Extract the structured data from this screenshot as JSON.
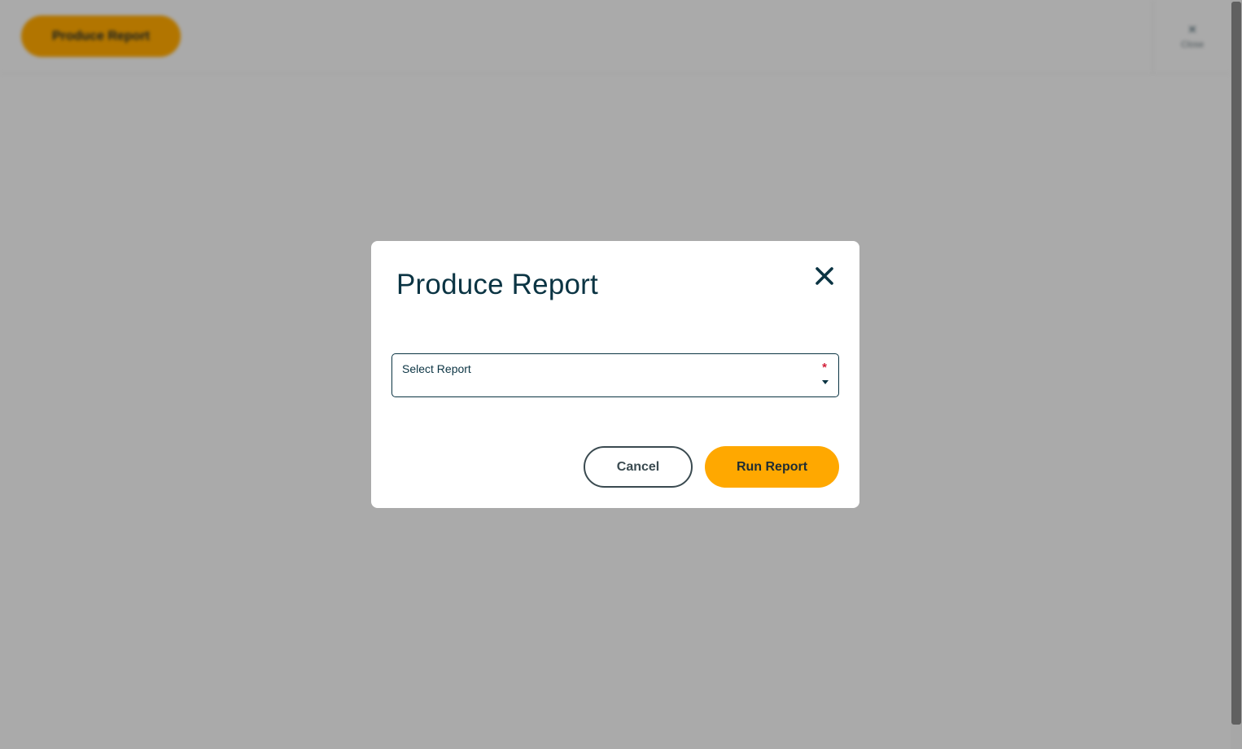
{
  "page": {
    "produce_report_button": "Produce Report",
    "side_panel_label": "Close"
  },
  "dialog": {
    "title": "Produce Report",
    "select": {
      "label": "Select Report",
      "required_marker": "*",
      "value": ""
    },
    "cancel_label": "Cancel",
    "run_label": "Run Report"
  },
  "icons": {
    "close": "close-icon",
    "dropdown": "chevron-down-icon"
  },
  "colors": {
    "primary_dark": "#0b3443",
    "accent": "#ffa800",
    "required": "#d2203a",
    "overlay": "rgba(0,0,0,0.30)"
  }
}
